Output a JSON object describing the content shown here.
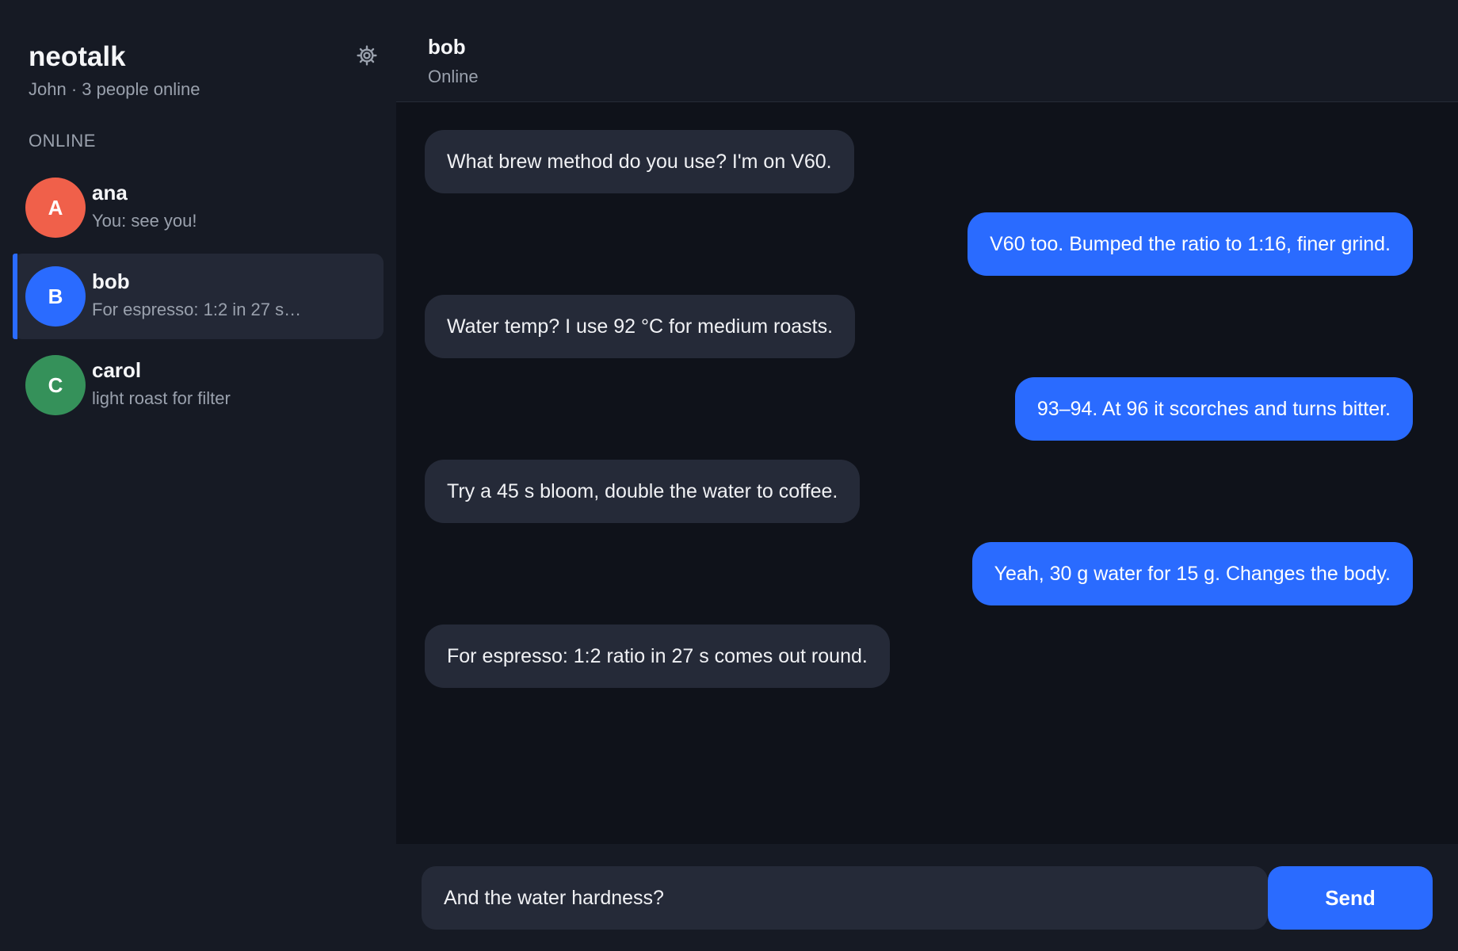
{
  "app": {
    "title": "neotalk",
    "subtitle": "John · 3 people online"
  },
  "sidebar": {
    "section_label": "ONLINE",
    "settings_icon": "gear-icon",
    "contacts": [
      {
        "initial": "A",
        "name": "ana",
        "preview": "You: see you!",
        "color": "#f0604a",
        "active": false
      },
      {
        "initial": "B",
        "name": "bob",
        "preview": "For espresso: 1:2 in 27 s…",
        "color": "#2a6bff",
        "active": true
      },
      {
        "initial": "C",
        "name": "carol",
        "preview": "light roast for filter",
        "color": "#35915a",
        "active": false
      }
    ]
  },
  "chat": {
    "name": "bob",
    "status": "Online",
    "messages": [
      {
        "direction": "in",
        "text": "What brew method do you use? I'm on V60."
      },
      {
        "direction": "out",
        "text": "V60 too. Bumped the ratio to 1:16, finer grind."
      },
      {
        "direction": "in",
        "text": "Water temp? I use 92 °C for medium roasts."
      },
      {
        "direction": "out",
        "text": "93–94. At 96 it scorches and turns bitter."
      },
      {
        "direction": "in",
        "text": "Try a 45 s bloom, double the water to coffee."
      },
      {
        "direction": "out",
        "text": "Yeah, 30 g water for 15 g. Changes the body."
      },
      {
        "direction": "in",
        "text": "For espresso: 1:2 ratio in 27 s comes out round."
      }
    ]
  },
  "composer": {
    "value": "And the water hardness?",
    "send_label": "Send"
  },
  "colors": {
    "accent": "#2a6bff",
    "sidebar_bg": "#161a24",
    "main_bg": "#0f121a",
    "bubble_in": "#252a38"
  }
}
